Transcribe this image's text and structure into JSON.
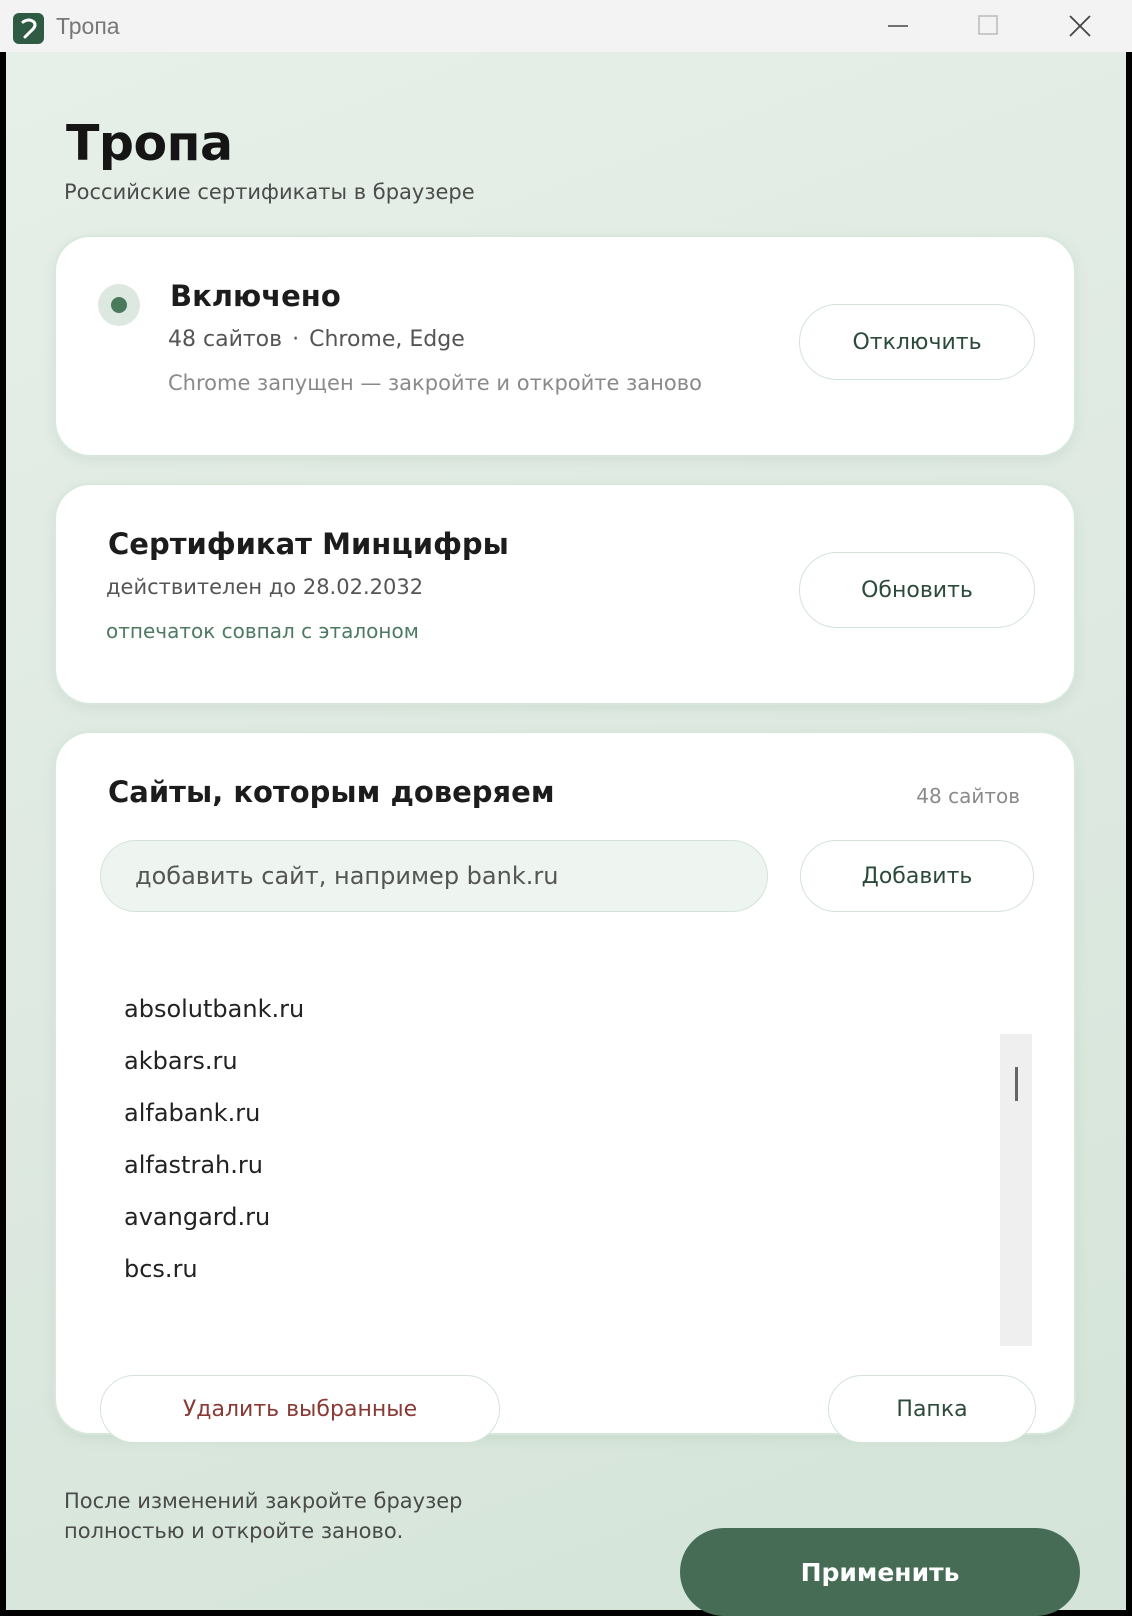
{
  "window": {
    "title": "Тропа",
    "icon": "app-logo-icon"
  },
  "header": {
    "title": "Тропа",
    "subtitle": "Российские сертификаты в браузере"
  },
  "status": {
    "title": "Включено",
    "sites": "48 сайтов",
    "separator": "·",
    "browsers": "Chrome, Edge",
    "note": "Chrome запущен — закройте и откройте заново",
    "button_label": "Отключить",
    "indicator_color": "#4a7a5c"
  },
  "certificate": {
    "title": "Сертификат Минцифры",
    "validity": "действителен до 28.02.2032",
    "fingerprint": "отпечаток совпал с эталоном",
    "button_label": "Обновить"
  },
  "sites": {
    "title": "Сайты, которым доверяем",
    "count": "48 сайтов",
    "input_placeholder": "добавить сайт, например bank.ru",
    "add_label": "Добавить",
    "items": [
      "absolutbank.ru",
      "akbars.ru",
      "alfabank.ru",
      "alfastrah.ru",
      "avangard.ru",
      "bcs.ru"
    ],
    "delete_label": "Удалить выбранные",
    "folder_label": "Папка"
  },
  "footer": {
    "note_line1": "После изменений закройте браузер",
    "note_line2": "полностью и откройте заново.",
    "apply_label": "Применить"
  },
  "colors": {
    "accent": "#466c56",
    "danger": "#8a3a34",
    "background": "#dfeae2"
  }
}
